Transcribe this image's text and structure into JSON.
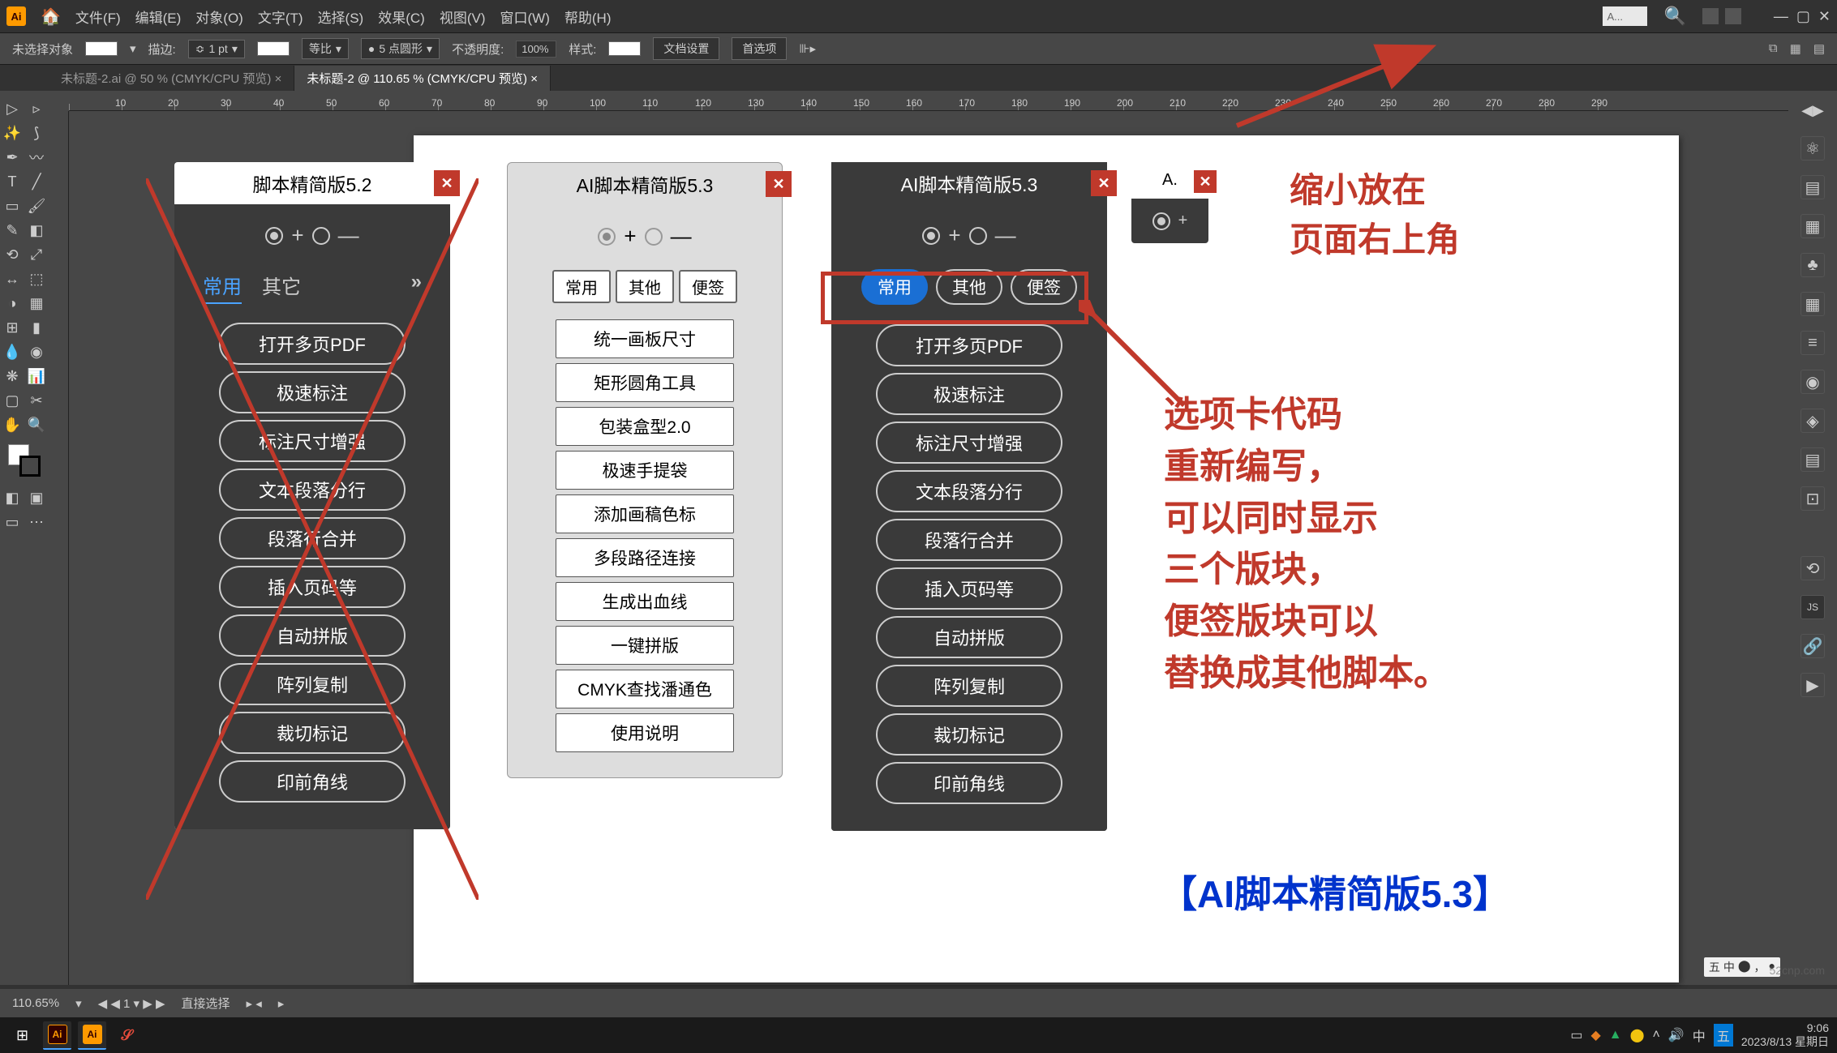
{
  "menubar": {
    "app_initials": "Ai",
    "items": [
      "文件(F)",
      "编辑(E)",
      "对象(O)",
      "文字(T)",
      "选择(S)",
      "效果(C)",
      "视图(V)",
      "窗口(W)",
      "帮助(H)"
    ],
    "title_search": "A..."
  },
  "controlbar": {
    "no_selection": "未选择对象",
    "stroke_label": "描边:",
    "stroke_value": "1 pt",
    "uniform": "等比",
    "corner_label": "5 点圆形",
    "opacity_label": "不透明度:",
    "opacity_value": "100%",
    "style_label": "样式:",
    "doc_setup": "文档设置",
    "prefs": "首选项"
  },
  "tabs": {
    "tab1": "未标题-2.ai @ 50 % (CMYK/CPU 预览)",
    "tab2": "未标题-2 @ 110.65 % (CMYK/CPU 预览)"
  },
  "statusbar": {
    "zoom": "110.65%",
    "tool": "直接选择"
  },
  "panel52": {
    "title": "脚本精简版5.2",
    "tabs": [
      "常用",
      "其它"
    ],
    "buttons": [
      "打开多页PDF",
      "极速标注",
      "标注尺寸增强",
      "文本段落分行",
      "段落行合并",
      "插入页码等",
      "自动拼版",
      "阵列复制",
      "裁切标记",
      "印前角线"
    ]
  },
  "panel53w": {
    "title": "AI脚本精简版5.3",
    "tabs": [
      "常用",
      "其他",
      "便签"
    ],
    "buttons": [
      "统一画板尺寸",
      "矩形圆角工具",
      "包装盒型2.0",
      "极速手提袋",
      "添加画稿色标",
      "多段路径连接",
      "生成出血线",
      "一键拼版",
      "CMYK查找潘通色",
      "使用说明"
    ]
  },
  "panel53d": {
    "title": "AI脚本精简版5.3",
    "tabs": [
      "常用",
      "其他",
      "便签"
    ],
    "buttons": [
      "打开多页PDF",
      "极速标注",
      "标注尺寸增强",
      "文本段落分行",
      "段落行合并",
      "插入页码等",
      "自动拼版",
      "阵列复制",
      "裁切标记",
      "印前角线"
    ]
  },
  "panel_mini": {
    "title": "A."
  },
  "annotations": {
    "a1_line1": "缩小放在",
    "a1_line2": "页面右上角",
    "a2_line1": "选项卡代码",
    "a2_line2": "重新编写，",
    "a2_line3": "可以同时显示",
    "a2_line4": "三个版块，",
    "a2_line5": "便签版块可以",
    "a2_line6": "替换成其他脚本。",
    "a3": "【AI脚本精简版5.3】"
  },
  "taskbar": {
    "time": "9:06",
    "date": "2023/8/13 星期日"
  },
  "ime_tray": [
    "五",
    "中",
    "⬤",
    "，",
    "●"
  ],
  "watermark": "52cnp.com"
}
